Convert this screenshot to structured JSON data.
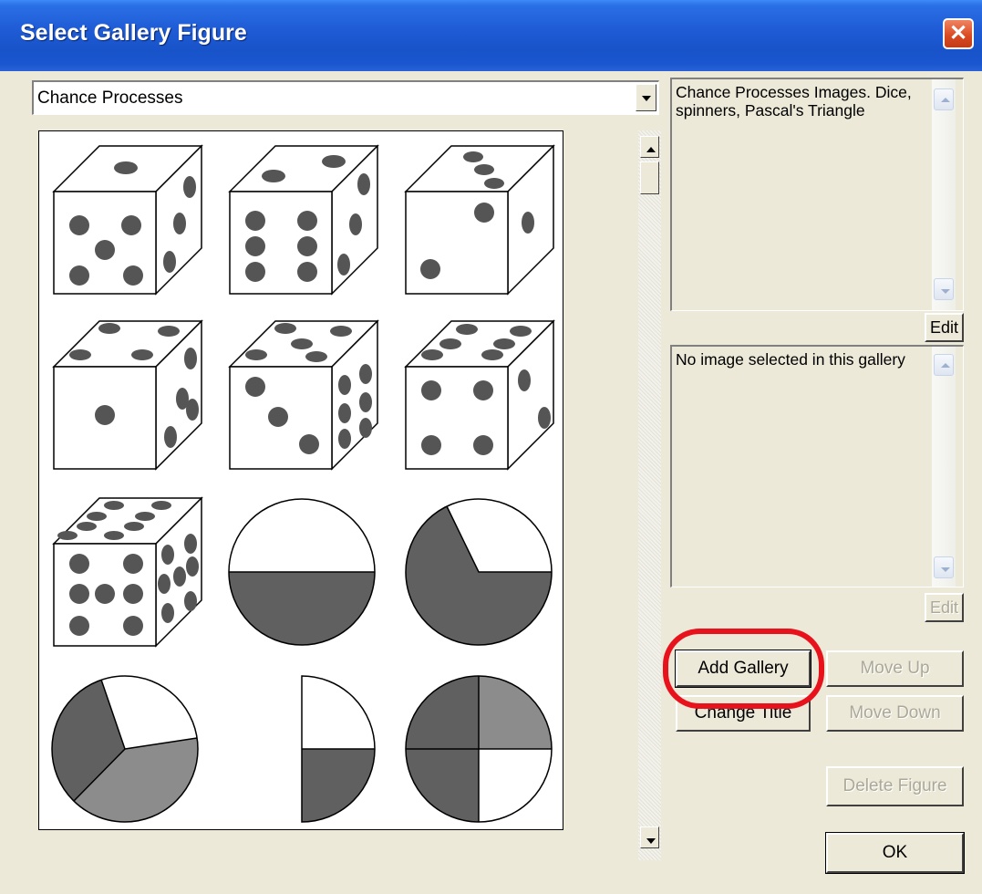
{
  "window": {
    "title": "Select Gallery Figure"
  },
  "combo": {
    "selected": "Chance Processes"
  },
  "description_box": {
    "text": "Chance Processes Images. Dice, spinners, Pascal's Triangle"
  },
  "description_edit": {
    "label": "Edit"
  },
  "figure_box": {
    "text": "No image selected in this gallery"
  },
  "figure_edit": {
    "label": "Edit"
  },
  "buttons": {
    "add_gallery": "Add Gallery",
    "move_up": "Move Up",
    "change_title": "Change Title",
    "move_down": "Move Down",
    "delete_figure": "Delete Figure",
    "ok": "OK"
  },
  "gallery_items": [
    {
      "type": "die",
      "name": "die"
    },
    {
      "type": "die",
      "name": "die"
    },
    {
      "type": "die",
      "name": "die"
    },
    {
      "type": "die",
      "name": "die"
    },
    {
      "type": "die",
      "name": "die"
    },
    {
      "type": "die",
      "name": "die"
    },
    {
      "type": "die",
      "name": "die"
    },
    {
      "type": "spinner",
      "name": "spinner-halves"
    },
    {
      "type": "spinner",
      "name": "spinner-thirds"
    },
    {
      "type": "spinner",
      "name": "spinner-three-parts"
    },
    {
      "type": "spinner",
      "name": "half-spinner-quarters"
    },
    {
      "type": "spinner",
      "name": "spinner-quarters"
    }
  ],
  "colors": {
    "shade_dark": "#606060",
    "shade_light": "#8c8c8c",
    "highlight_ring": "#e8121c",
    "titlebar": "#1f5cd6"
  }
}
